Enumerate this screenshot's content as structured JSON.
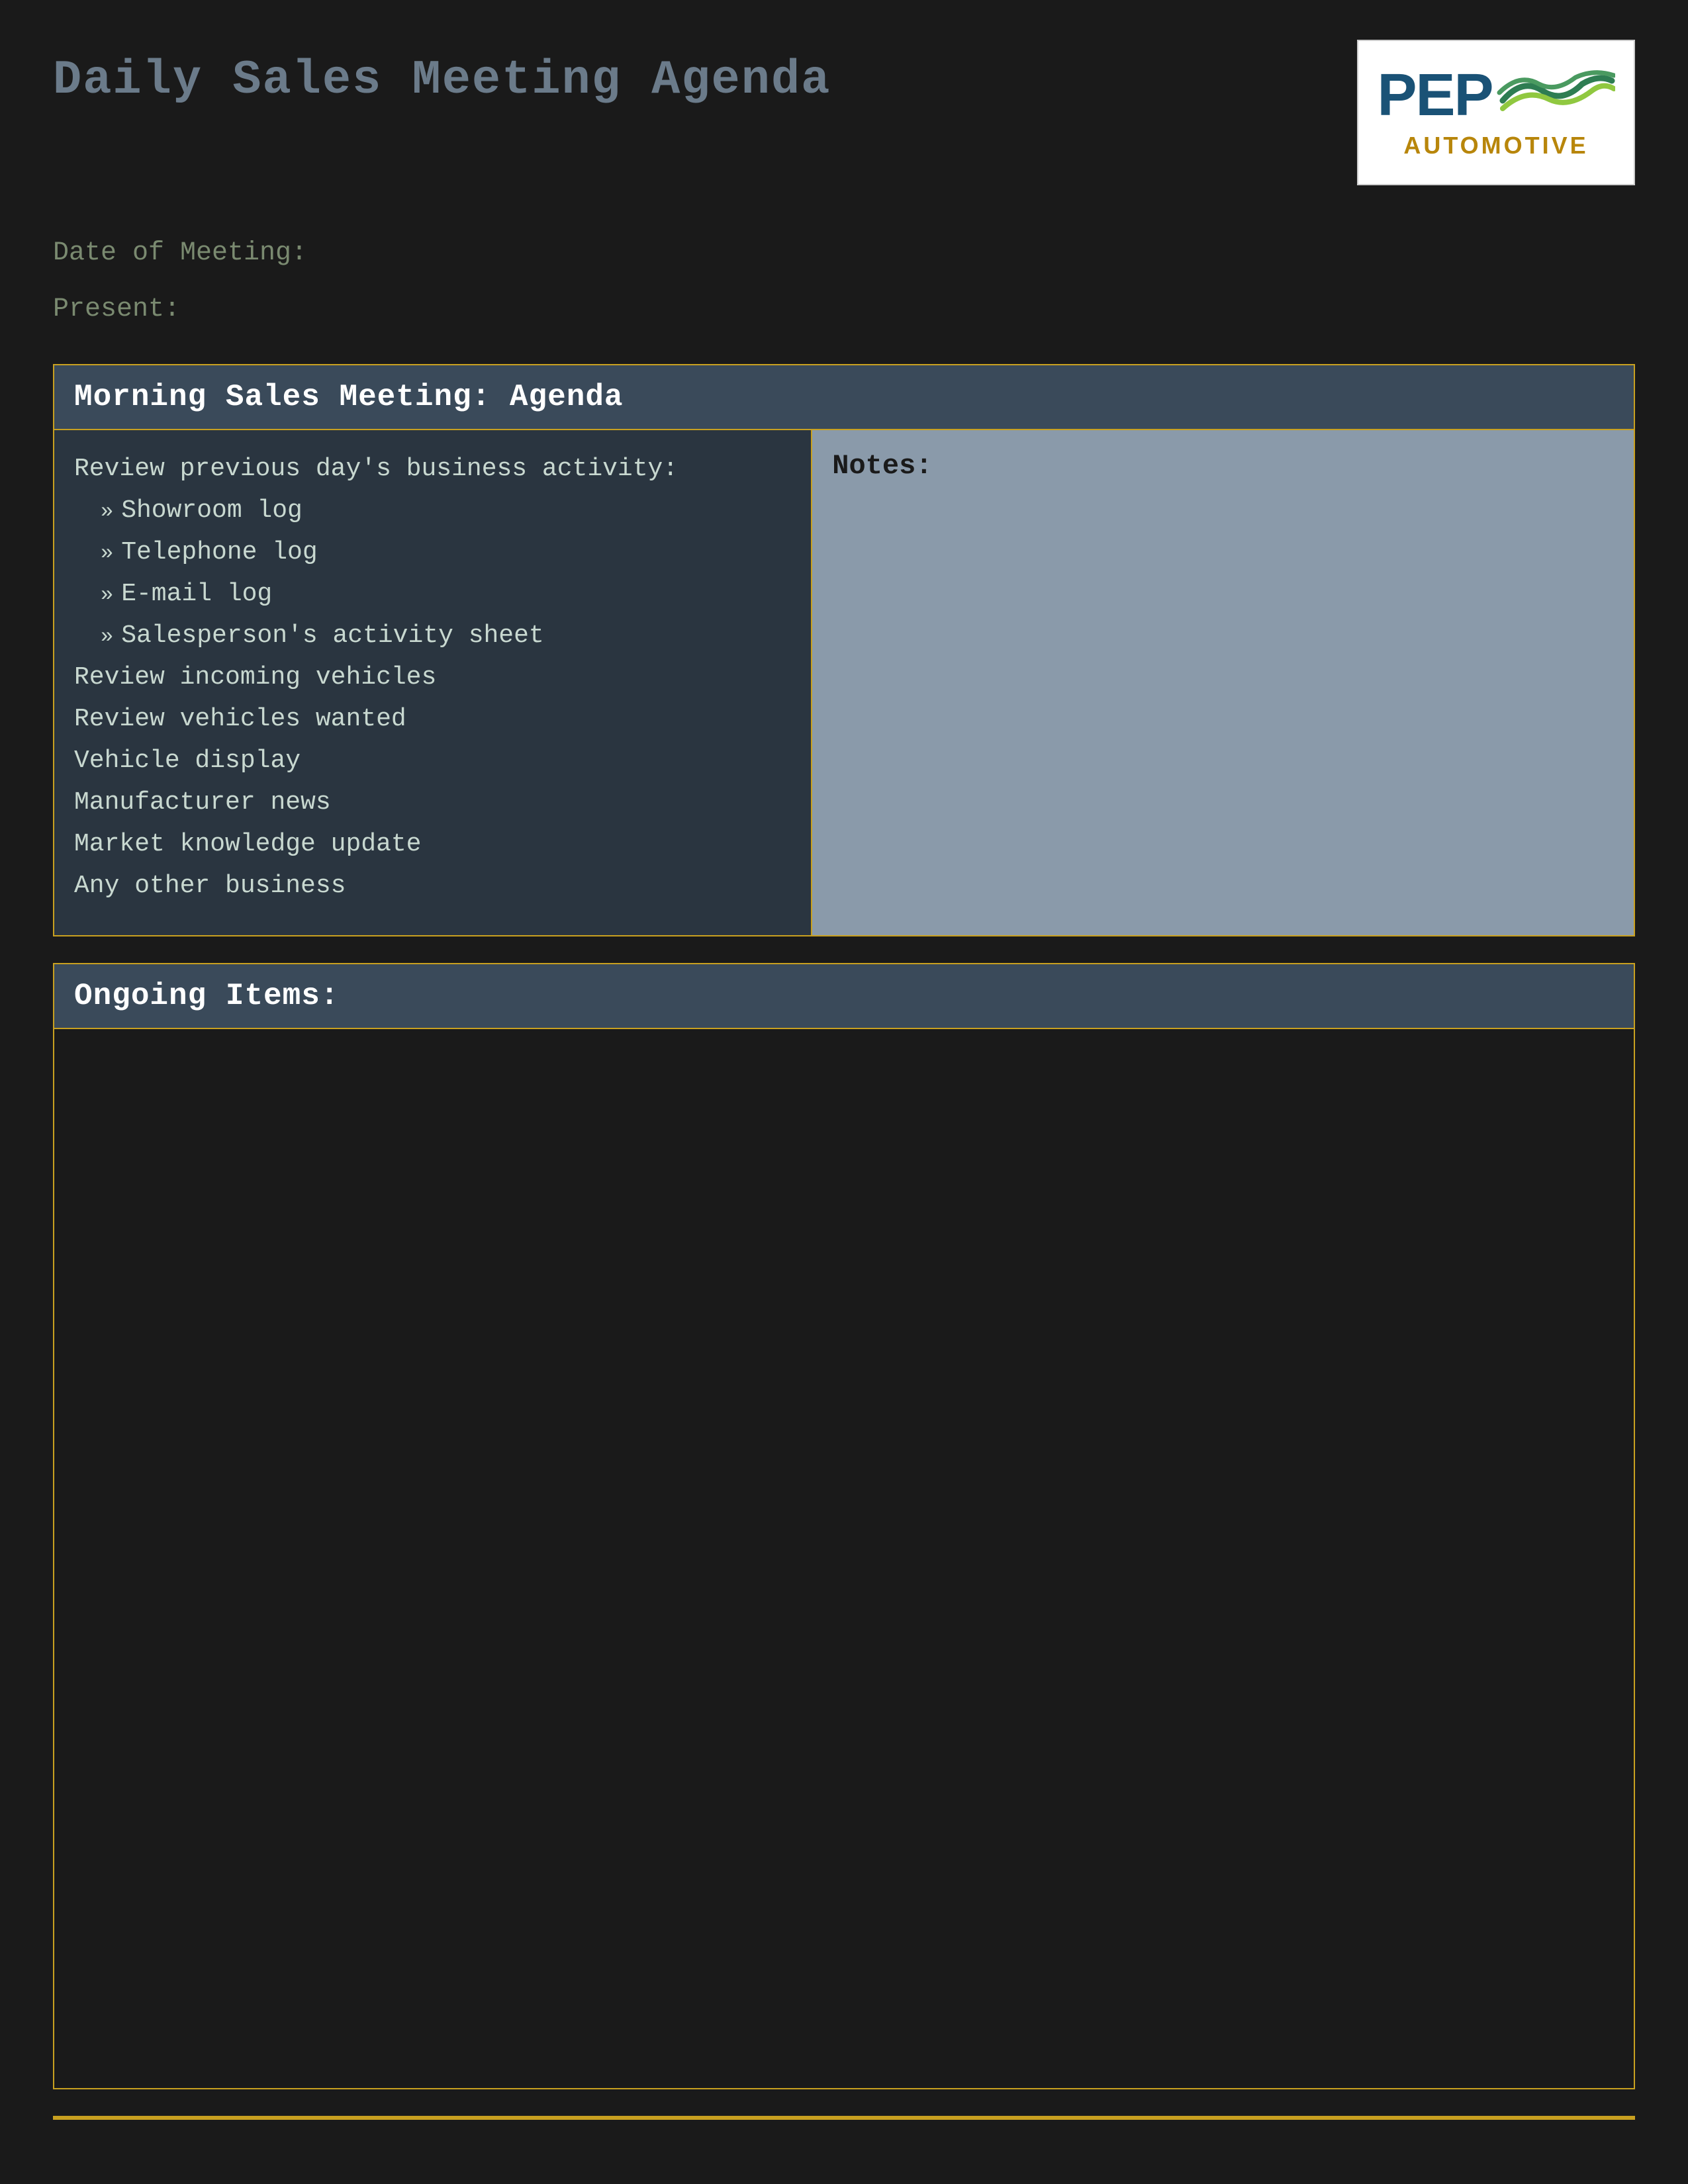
{
  "page": {
    "background_color": "#1a1a1a"
  },
  "header": {
    "title": "Daily Sales Meeting Agenda"
  },
  "logo": {
    "pep_text": "PEP",
    "automotive_text": "AUTOMOTIVE",
    "wave_color_green": "#4a9a60",
    "wave_color_light_green": "#90c840",
    "brand_color": "#1a5276",
    "accent_color": "#b8860b"
  },
  "meta": {
    "date_label": "Date of Meeting:",
    "present_label": "Present:"
  },
  "morning_section": {
    "title": "Morning Sales Meeting: Agenda",
    "review_header": "Review previous day's business activity:",
    "items": [
      {
        "text": "Showroom log",
        "indent": true
      },
      {
        "text": "Telephone log",
        "indent": true
      },
      {
        "text": "E-mail log",
        "indent": true
      },
      {
        "text": "Salesperson's activity sheet",
        "indent": true
      },
      {
        "text": "Review incoming vehicles",
        "indent": false
      },
      {
        "text": "Review vehicles wanted",
        "indent": false
      },
      {
        "text": "Vehicle display",
        "indent": false
      },
      {
        "text": "Manufacturer news",
        "indent": false
      },
      {
        "text": "Market knowledge update",
        "indent": false
      },
      {
        "text": "Any other business",
        "indent": false
      }
    ],
    "notes_label": "Notes:"
  },
  "ongoing_section": {
    "title": "Ongoing Items:"
  },
  "colors": {
    "gold_border": "#c8a020",
    "section_header_bg": "#3a4a5a",
    "agenda_body_bg": "#2a3540",
    "notes_bg": "#8a9aaa",
    "text_color": "#c8d8d0",
    "header_text": "#ffffff"
  }
}
